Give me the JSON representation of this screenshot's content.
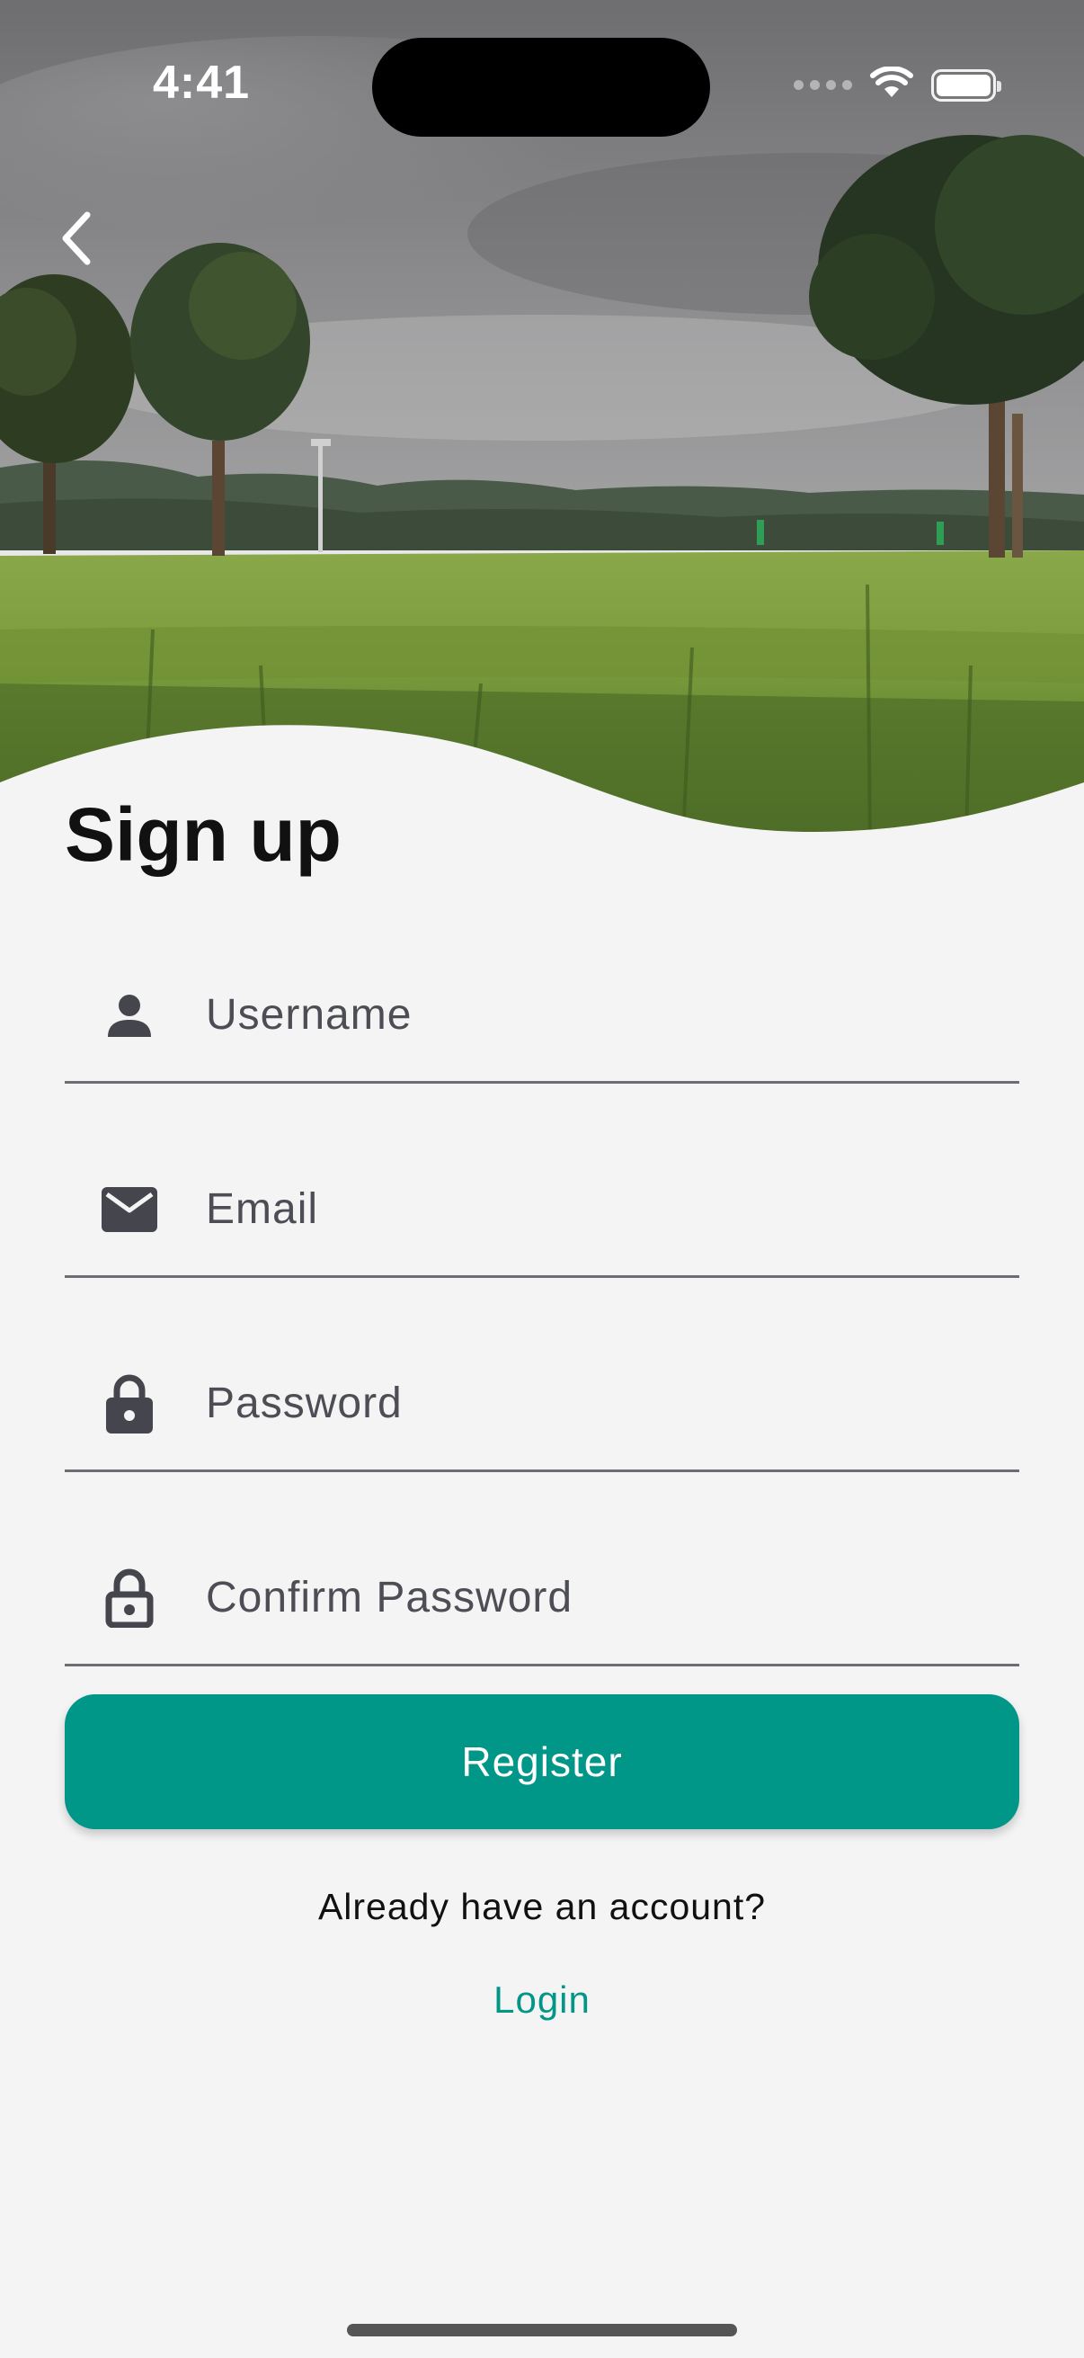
{
  "status_bar": {
    "time": "4:41",
    "icons": [
      "signal-icon",
      "wifi-icon",
      "battery-icon"
    ]
  },
  "header": {
    "back_icon": "chevron-left-icon",
    "hero_image": "landscape-photo"
  },
  "form": {
    "title": "Sign up",
    "fields": [
      {
        "icon": "person-icon",
        "placeholder": "Username",
        "value": ""
      },
      {
        "icon": "mail-icon",
        "placeholder": "Email",
        "value": ""
      },
      {
        "icon": "lock-icon",
        "placeholder": "Password",
        "value": ""
      },
      {
        "icon": "lock-outline-icon",
        "placeholder": "Confirm Password",
        "value": ""
      }
    ],
    "register_label": "Register"
  },
  "footer": {
    "account_text": "Already have an account?",
    "login_label": "Login"
  },
  "colors": {
    "accent": "#009688",
    "background": "#f4f4f4",
    "icon": "#45454d"
  }
}
